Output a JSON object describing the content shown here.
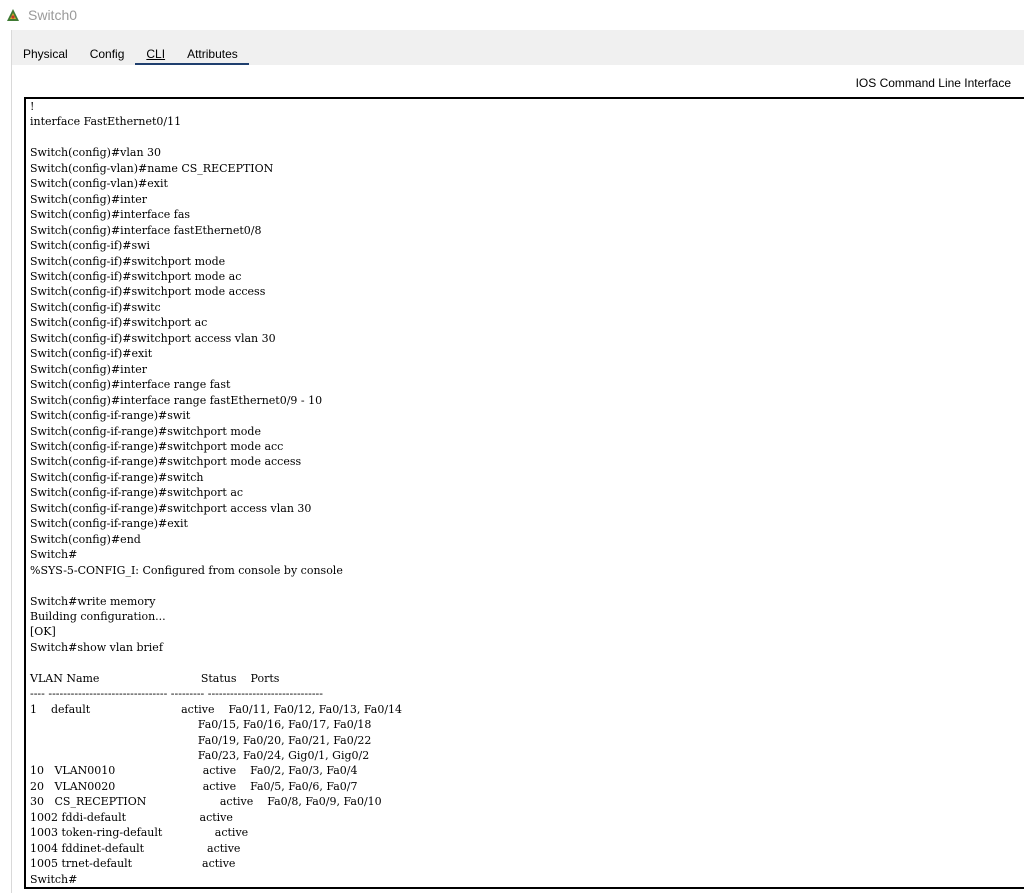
{
  "window": {
    "title": "Switch0",
    "icon": "packet-tracer-switch-icon"
  },
  "tabs": [
    {
      "label": "Physical",
      "active": false
    },
    {
      "label": "Config",
      "active": false
    },
    {
      "label": "CLI",
      "active": true
    },
    {
      "label": "Attributes",
      "active": false
    }
  ],
  "panel": {
    "title": "IOS Command Line Interface"
  },
  "terminal": {
    "lines": [
      "!",
      "interface FastEthernet0/11",
      "",
      "Switch(config)#vlan 30",
      "Switch(config-vlan)#name CS_RECEPTION",
      "Switch(config-vlan)#exit",
      "Switch(config)#inter",
      "Switch(config)#interface fas",
      "Switch(config)#interface fastEthernet0/8",
      "Switch(config-if)#swi",
      "Switch(config-if)#switchport mode",
      "Switch(config-if)#switchport mode ac",
      "Switch(config-if)#switchport mode access",
      "Switch(config-if)#switc",
      "Switch(config-if)#switchport ac",
      "Switch(config-if)#switchport access vlan 30",
      "Switch(config-if)#exit",
      "Switch(config)#inter",
      "Switch(config)#interface range fast",
      "Switch(config)#interface range fastEthernet0/9 - 10",
      "Switch(config-if-range)#swit",
      "Switch(config-if-range)#switchport mode",
      "Switch(config-if-range)#switchport mode acc",
      "Switch(config-if-range)#switchport mode access",
      "Switch(config-if-range)#switch",
      "Switch(config-if-range)#switchport ac",
      "Switch(config-if-range)#switchport access vlan 30",
      "Switch(config-if-range)#exit",
      "Switch(config)#end",
      "Switch#",
      "%SYS-5-CONFIG_I: Configured from console by console",
      "",
      "Switch#write memory",
      "Building configuration...",
      "[OK]",
      "Switch#show vlan brief",
      "",
      "VLAN Name                             Status    Ports",
      "---- -------------------------------- --------- -------------------------------",
      "1    default                          active    Fa0/11, Fa0/12, Fa0/13, Fa0/14",
      "                                                Fa0/15, Fa0/16, Fa0/17, Fa0/18",
      "                                                Fa0/19, Fa0/20, Fa0/21, Fa0/22",
      "                                                Fa0/23, Fa0/24, Gig0/1, Gig0/2",
      "10   VLAN0010                         active    Fa0/2, Fa0/3, Fa0/4",
      "20   VLAN0020                         active    Fa0/5, Fa0/6, Fa0/7",
      "30   CS_RECEPTION                     active    Fa0/8, Fa0/9, Fa0/10",
      "1002 fddi-default                     active",
      "1003 token-ring-default               active",
      "1004 fddinet-default                  active",
      "1005 trnet-default                    active",
      "Switch#"
    ]
  }
}
